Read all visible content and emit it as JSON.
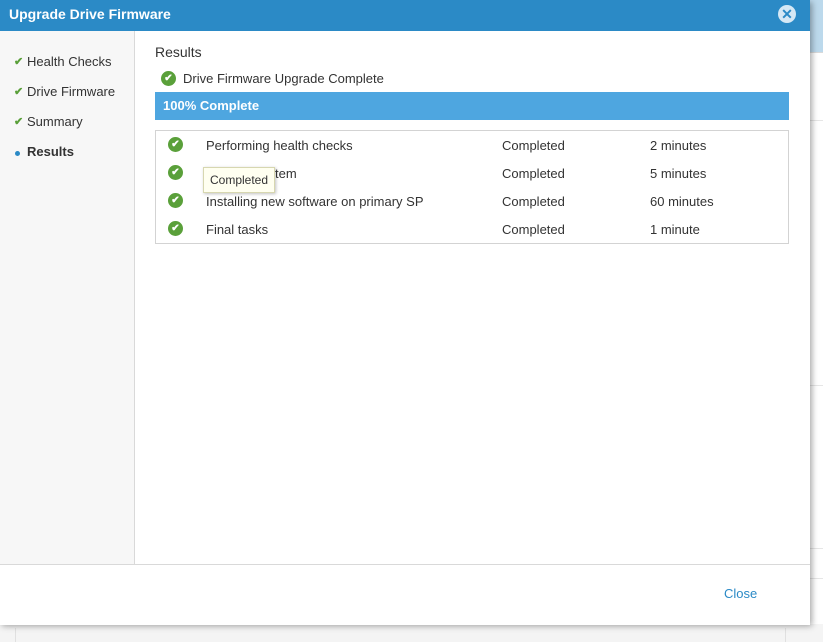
{
  "dialog": {
    "title": "Upgrade Drive Firmware",
    "close_icon": "close-icon"
  },
  "sidebar": {
    "steps": [
      {
        "label": "Health Checks",
        "state": "done",
        "icon": "check-icon"
      },
      {
        "label": "Drive Firmware",
        "state": "done",
        "icon": "check-icon"
      },
      {
        "label": "Summary",
        "state": "done",
        "icon": "check-icon"
      },
      {
        "label": "Results",
        "state": "current",
        "icon": "bullet-icon"
      }
    ]
  },
  "results": {
    "heading": "Results",
    "status": "Drive Firmware Upgrade Complete",
    "progress_label": "100% Complete",
    "progress_value": 1.0,
    "tasks": [
      {
        "name": "Performing health checks",
        "status": "Completed",
        "duration": "2 minutes"
      },
      {
        "name": "ystem",
        "status": "Completed",
        "duration": "5 minutes"
      },
      {
        "name": "Installing new software on primary SP",
        "status": "Completed",
        "duration": "60 minutes"
      },
      {
        "name": "Final tasks",
        "status": "Completed",
        "duration": "1 minute"
      }
    ],
    "tooltip": "Completed"
  },
  "footer": {
    "close_label": "Close"
  },
  "colors": {
    "titlebar": "#2b8ac6",
    "progress": "#4ea6e0",
    "success": "#5aa03a",
    "link": "#2b8ac6"
  }
}
